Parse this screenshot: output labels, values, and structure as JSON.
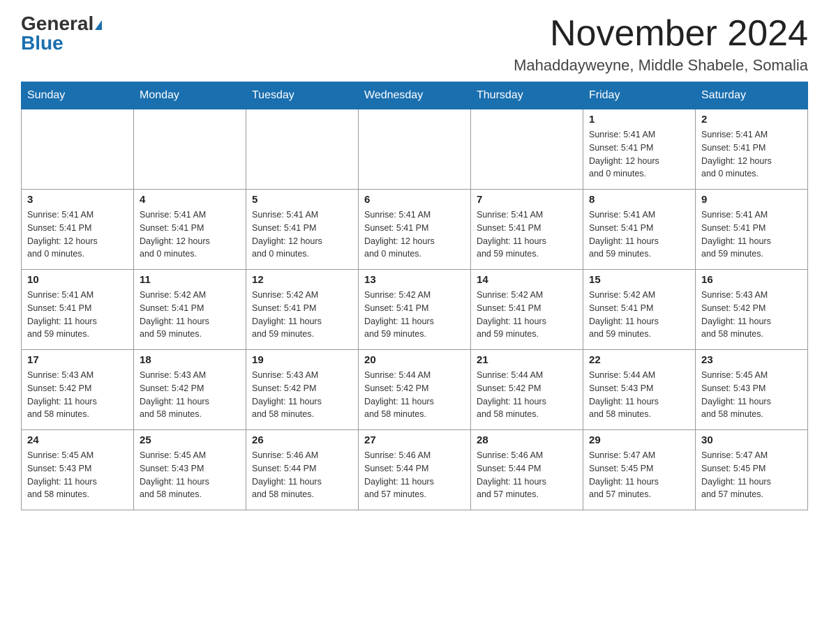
{
  "header": {
    "logo_general": "General",
    "logo_blue": "Blue",
    "month_title": "November 2024",
    "location": "Mahaddayweyne, Middle Shabele, Somalia"
  },
  "weekdays": [
    "Sunday",
    "Monday",
    "Tuesday",
    "Wednesday",
    "Thursday",
    "Friday",
    "Saturday"
  ],
  "weeks": [
    [
      {
        "day": "",
        "info": ""
      },
      {
        "day": "",
        "info": ""
      },
      {
        "day": "",
        "info": ""
      },
      {
        "day": "",
        "info": ""
      },
      {
        "day": "",
        "info": ""
      },
      {
        "day": "1",
        "info": "Sunrise: 5:41 AM\nSunset: 5:41 PM\nDaylight: 12 hours\nand 0 minutes."
      },
      {
        "day": "2",
        "info": "Sunrise: 5:41 AM\nSunset: 5:41 PM\nDaylight: 12 hours\nand 0 minutes."
      }
    ],
    [
      {
        "day": "3",
        "info": "Sunrise: 5:41 AM\nSunset: 5:41 PM\nDaylight: 12 hours\nand 0 minutes."
      },
      {
        "day": "4",
        "info": "Sunrise: 5:41 AM\nSunset: 5:41 PM\nDaylight: 12 hours\nand 0 minutes."
      },
      {
        "day": "5",
        "info": "Sunrise: 5:41 AM\nSunset: 5:41 PM\nDaylight: 12 hours\nand 0 minutes."
      },
      {
        "day": "6",
        "info": "Sunrise: 5:41 AM\nSunset: 5:41 PM\nDaylight: 12 hours\nand 0 minutes."
      },
      {
        "day": "7",
        "info": "Sunrise: 5:41 AM\nSunset: 5:41 PM\nDaylight: 11 hours\nand 59 minutes."
      },
      {
        "day": "8",
        "info": "Sunrise: 5:41 AM\nSunset: 5:41 PM\nDaylight: 11 hours\nand 59 minutes."
      },
      {
        "day": "9",
        "info": "Sunrise: 5:41 AM\nSunset: 5:41 PM\nDaylight: 11 hours\nand 59 minutes."
      }
    ],
    [
      {
        "day": "10",
        "info": "Sunrise: 5:41 AM\nSunset: 5:41 PM\nDaylight: 11 hours\nand 59 minutes."
      },
      {
        "day": "11",
        "info": "Sunrise: 5:42 AM\nSunset: 5:41 PM\nDaylight: 11 hours\nand 59 minutes."
      },
      {
        "day": "12",
        "info": "Sunrise: 5:42 AM\nSunset: 5:41 PM\nDaylight: 11 hours\nand 59 minutes."
      },
      {
        "day": "13",
        "info": "Sunrise: 5:42 AM\nSunset: 5:41 PM\nDaylight: 11 hours\nand 59 minutes."
      },
      {
        "day": "14",
        "info": "Sunrise: 5:42 AM\nSunset: 5:41 PM\nDaylight: 11 hours\nand 59 minutes."
      },
      {
        "day": "15",
        "info": "Sunrise: 5:42 AM\nSunset: 5:41 PM\nDaylight: 11 hours\nand 59 minutes."
      },
      {
        "day": "16",
        "info": "Sunrise: 5:43 AM\nSunset: 5:42 PM\nDaylight: 11 hours\nand 58 minutes."
      }
    ],
    [
      {
        "day": "17",
        "info": "Sunrise: 5:43 AM\nSunset: 5:42 PM\nDaylight: 11 hours\nand 58 minutes."
      },
      {
        "day": "18",
        "info": "Sunrise: 5:43 AM\nSunset: 5:42 PM\nDaylight: 11 hours\nand 58 minutes."
      },
      {
        "day": "19",
        "info": "Sunrise: 5:43 AM\nSunset: 5:42 PM\nDaylight: 11 hours\nand 58 minutes."
      },
      {
        "day": "20",
        "info": "Sunrise: 5:44 AM\nSunset: 5:42 PM\nDaylight: 11 hours\nand 58 minutes."
      },
      {
        "day": "21",
        "info": "Sunrise: 5:44 AM\nSunset: 5:42 PM\nDaylight: 11 hours\nand 58 minutes."
      },
      {
        "day": "22",
        "info": "Sunrise: 5:44 AM\nSunset: 5:43 PM\nDaylight: 11 hours\nand 58 minutes."
      },
      {
        "day": "23",
        "info": "Sunrise: 5:45 AM\nSunset: 5:43 PM\nDaylight: 11 hours\nand 58 minutes."
      }
    ],
    [
      {
        "day": "24",
        "info": "Sunrise: 5:45 AM\nSunset: 5:43 PM\nDaylight: 11 hours\nand 58 minutes."
      },
      {
        "day": "25",
        "info": "Sunrise: 5:45 AM\nSunset: 5:43 PM\nDaylight: 11 hours\nand 58 minutes."
      },
      {
        "day": "26",
        "info": "Sunrise: 5:46 AM\nSunset: 5:44 PM\nDaylight: 11 hours\nand 58 minutes."
      },
      {
        "day": "27",
        "info": "Sunrise: 5:46 AM\nSunset: 5:44 PM\nDaylight: 11 hours\nand 57 minutes."
      },
      {
        "day": "28",
        "info": "Sunrise: 5:46 AM\nSunset: 5:44 PM\nDaylight: 11 hours\nand 57 minutes."
      },
      {
        "day": "29",
        "info": "Sunrise: 5:47 AM\nSunset: 5:45 PM\nDaylight: 11 hours\nand 57 minutes."
      },
      {
        "day": "30",
        "info": "Sunrise: 5:47 AM\nSunset: 5:45 PM\nDaylight: 11 hours\nand 57 minutes."
      }
    ]
  ]
}
